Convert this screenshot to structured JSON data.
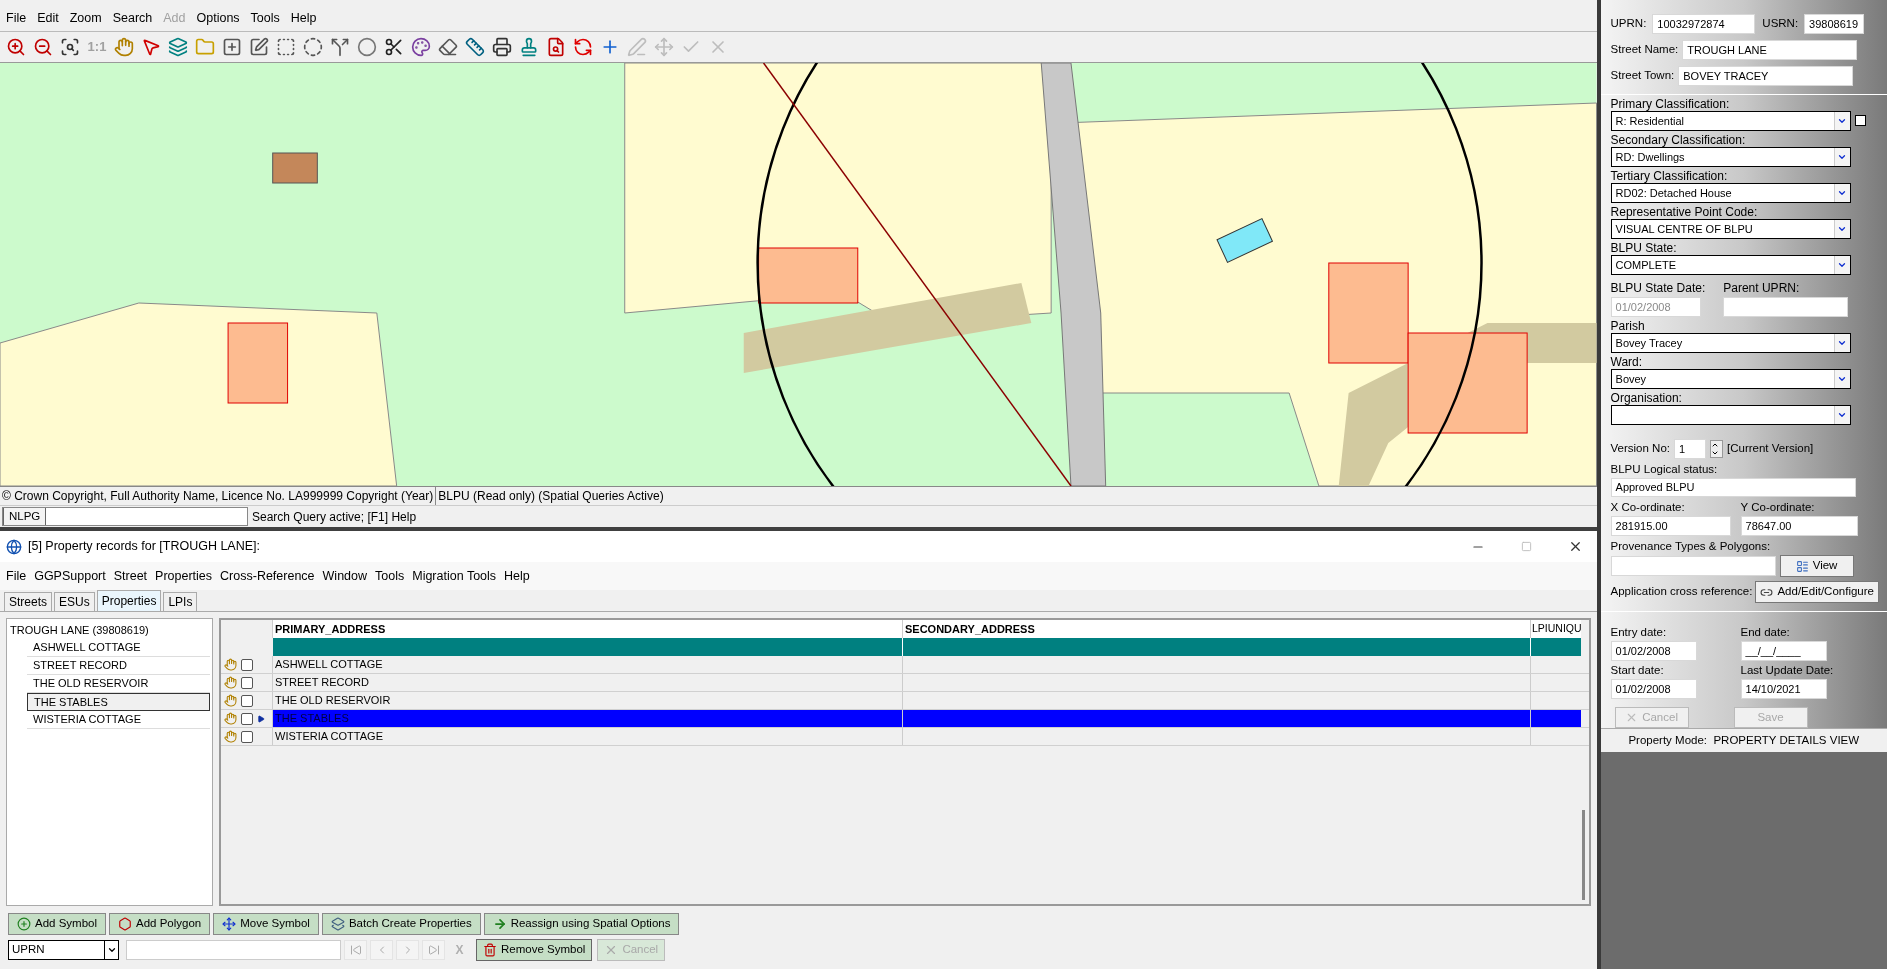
{
  "menu": [
    {
      "label": "File",
      "disabled": false
    },
    {
      "label": "Edit",
      "disabled": false
    },
    {
      "label": "Zoom",
      "disabled": false
    },
    {
      "label": "Search",
      "disabled": false
    },
    {
      "label": "Add",
      "disabled": true
    },
    {
      "label": "Options",
      "disabled": false
    },
    {
      "label": "Tools",
      "disabled": false
    },
    {
      "label": "Help",
      "disabled": false
    }
  ],
  "toolbar": [
    {
      "kind": "zoom-in",
      "disabled": false
    },
    {
      "kind": "zoom-out",
      "disabled": false
    },
    {
      "kind": "zoom-extent",
      "disabled": false
    },
    {
      "kind": "text",
      "label": "1:1",
      "disabled": true
    },
    {
      "kind": "hand",
      "disabled": false
    },
    {
      "kind": "pointer",
      "disabled": false
    },
    {
      "kind": "layers",
      "disabled": false
    },
    {
      "kind": "folder",
      "disabled": false
    },
    {
      "kind": "shape-add",
      "disabled": false
    },
    {
      "kind": "shape-edit",
      "disabled": false
    },
    {
      "kind": "shape-cut",
      "disabled": false
    },
    {
      "kind": "shape-circle",
      "disabled": false
    },
    {
      "kind": "shape-split",
      "disabled": false
    },
    {
      "kind": "blob",
      "disabled": false
    },
    {
      "kind": "scissors",
      "disabled": false
    },
    {
      "kind": "palette",
      "disabled": false
    },
    {
      "kind": "eraser",
      "disabled": false
    },
    {
      "kind": "ruler",
      "disabled": false
    },
    {
      "kind": "printer",
      "disabled": false
    },
    {
      "kind": "stamp",
      "disabled": false
    },
    {
      "kind": "print-preview",
      "disabled": false
    },
    {
      "kind": "refresh-alert",
      "disabled": false
    },
    {
      "kind": "add-point",
      "disabled": false
    },
    {
      "kind": "pen",
      "disabled": true
    },
    {
      "kind": "move",
      "disabled": true
    },
    {
      "kind": "check",
      "disabled": true
    },
    {
      "kind": "close",
      "disabled": true
    }
  ],
  "status_bar": {
    "copyright": "© Crown Copyright, Full Authority Name, Licence No. LA999999 Copyright (Year)",
    "mode": "BLPU (Read only) (Spatial Queries Active)"
  },
  "query_bar": {
    "tab": "NLPG",
    "message": "Search Query active; [F1] Help"
  },
  "records_window": {
    "title": "[5] Property records for [TROUGH LANE]:",
    "menu": [
      "File",
      "GGPSupport",
      "Street",
      "Properties",
      "Cross-Reference",
      "Window",
      "Tools",
      "Migration Tools",
      "Help"
    ],
    "tabs": [
      {
        "label": "Streets",
        "selected": false
      },
      {
        "label": "ESUs",
        "selected": false
      },
      {
        "label": "Properties",
        "selected": true
      },
      {
        "label": "LPIs",
        "selected": false
      }
    ],
    "tree": {
      "label": "TROUGH LANE (39808619)",
      "children": [
        {
          "label": "ASHWELL COTTAGE",
          "selected": false
        },
        {
          "label": "STREET RECORD",
          "selected": false
        },
        {
          "label": "THE OLD RESERVOIR",
          "selected": false
        },
        {
          "label": "THE STABLES",
          "selected": true
        },
        {
          "label": "WISTERIA COTTAGE",
          "selected": false
        }
      ]
    },
    "table": {
      "columns": [
        "PRIMARY_ADDRESS",
        "SECONDARY_ADDRESS",
        "LPIUNIQU"
      ],
      "rows": [
        {
          "primary_address": "ASHWELL COTTAGE",
          "checked": false,
          "selected": false
        },
        {
          "primary_address": "STREET RECORD",
          "checked": false,
          "selected": false
        },
        {
          "primary_address": "THE OLD RESERVOIR",
          "checked": false,
          "selected": false
        },
        {
          "primary_address": "THE STABLES",
          "checked": false,
          "selected": true
        },
        {
          "primary_address": "WISTERIA COTTAGE",
          "checked": false,
          "selected": false
        }
      ]
    }
  },
  "action_buttons": [
    {
      "label": "Add Symbol",
      "kind": "add-symbol"
    },
    {
      "label": "Add Polygon",
      "kind": "add-polygon"
    },
    {
      "label": "Move Symbol",
      "kind": "move"
    },
    {
      "label": "Batch Create Properties",
      "kind": "batch"
    },
    {
      "label": "Reassign using Spatial Options",
      "kind": "reassign"
    }
  ],
  "search_bar": {
    "field": "UPRN",
    "nav_buttons": [
      {
        "kind": "first",
        "disabled": true
      },
      {
        "kind": "prev",
        "disabled": true
      },
      {
        "kind": "next",
        "disabled": true
      },
      {
        "kind": "last",
        "disabled": true
      }
    ],
    "clear": {
      "label": "X",
      "disabled": true
    }
  },
  "symbol_buttons": [
    {
      "label": "Remove Symbol",
      "kind": "remove",
      "disabled": false
    },
    {
      "label": "Cancel",
      "kind": "cancel",
      "disabled": true
    }
  ],
  "details": {
    "uprn": {
      "label": "UPRN:",
      "value": "10032972874"
    },
    "usrn": {
      "label": "USRN:",
      "value": "39808619"
    },
    "street_name": {
      "label": "Street Name:",
      "value": "TROUGH LANE"
    },
    "street_town": {
      "label": "Street Town:",
      "value": "BOVEY TRACEY"
    },
    "classifications": [
      {
        "label": "Primary Classification:",
        "value": "R: Residential"
      },
      {
        "label": "Secondary Classification:",
        "value": "RD: Dwellings"
      },
      {
        "label": "Tertiary Classification:",
        "value": "RD02: Detached House"
      },
      {
        "label": "Representative Point Code:",
        "value": "VISUAL CENTRE OF BLPU"
      },
      {
        "label": "BLPU State:",
        "value": "COMPLETE"
      }
    ],
    "primary_checked": false,
    "state_date": {
      "label": "BLPU State Date:",
      "value": "01/02/2008",
      "disabled": true
    },
    "parent_uprn": {
      "label": "Parent UPRN:"
    },
    "areas": [
      {
        "label": "Parish",
        "value": "Bovey Tracey"
      },
      {
        "label": "Ward:",
        "value": "Bovey"
      },
      {
        "label": "Organisation:"
      }
    ],
    "version": {
      "label": "Version No:",
      "value": "1",
      "note": "[Current Version]"
    },
    "logical_status": {
      "label": "BLPU Logical status:",
      "value": "Approved BLPU"
    },
    "x": {
      "label": "X Co-ordinate:",
      "value": "281915.00"
    },
    "y": {
      "label": "Y Co-ordinate:",
      "value": "78647.00"
    },
    "provenance": {
      "label": "Provenance Types & Polygons:",
      "button": "View"
    },
    "xref": {
      "label": "Application cross reference:",
      "button": "Add/Edit/Configure"
    },
    "dates": [
      {
        "label": "Entry date:",
        "value": "01/02/2008"
      },
      {
        "label": "End date:",
        "value": "__/__/____"
      },
      {
        "label": "Start date:",
        "value": "01/02/2008"
      },
      {
        "label": "Last Update Date:",
        "value": "14/10/2021"
      }
    ],
    "buttons": [
      {
        "label": "Cancel",
        "kind": "cancel",
        "disabled": true
      },
      {
        "label": "Save",
        "kind": "save",
        "disabled": true
      }
    ],
    "mode": "Property Mode:  PROPERTY DETAILS VIEW"
  }
}
